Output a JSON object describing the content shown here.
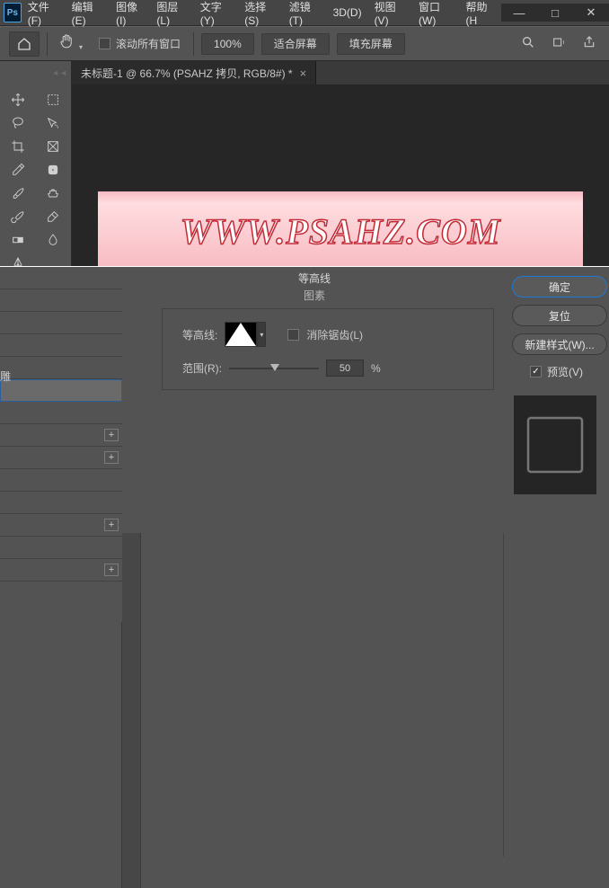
{
  "menu": {
    "file": "文件(F)",
    "edit": "编辑(E)",
    "image": "图像(I)",
    "layer": "图层(L)",
    "type": "文字(Y)",
    "select": "选择(S)",
    "filter": "滤镜(T)",
    "threeD": "3D(D)",
    "view": "视图(V)",
    "window": "窗口(W)",
    "help": "帮助(H"
  },
  "ps_logo": "Ps",
  "options": {
    "scroll_all": "滚动所有窗口",
    "zoom": "100%",
    "fit": "适合屏幕",
    "fill": "填充屏幕"
  },
  "tab": {
    "title": "未标题-1 @ 66.7% (PSAHZ 拷贝, RGB/8#) *",
    "close": "×"
  },
  "canvas": {
    "url": "WWW.PSAHZ.COM"
  },
  "tool_names": [
    "move",
    "marquee",
    "lasso",
    "magicwand",
    "crop",
    "slice",
    "eyedropper",
    "ruler",
    "brush",
    "clone",
    "history",
    "eraser",
    "gradient",
    "blur",
    "pen",
    "type"
  ],
  "dialog": {
    "title": "等高线",
    "subtitle": "图素",
    "contour_label": "等高线:",
    "antialias": "消除锯齿(L)",
    "range_label": "范围(R):",
    "range_value": "50",
    "range_unit": "%",
    "left_trunc": "雕",
    "ok": "确定",
    "reset": "复位",
    "newstyle": "新建样式(W)...",
    "preview": "预览(V)"
  },
  "fx_mark": "+",
  "win": {
    "min": "—",
    "max": "□",
    "close": "✕"
  }
}
